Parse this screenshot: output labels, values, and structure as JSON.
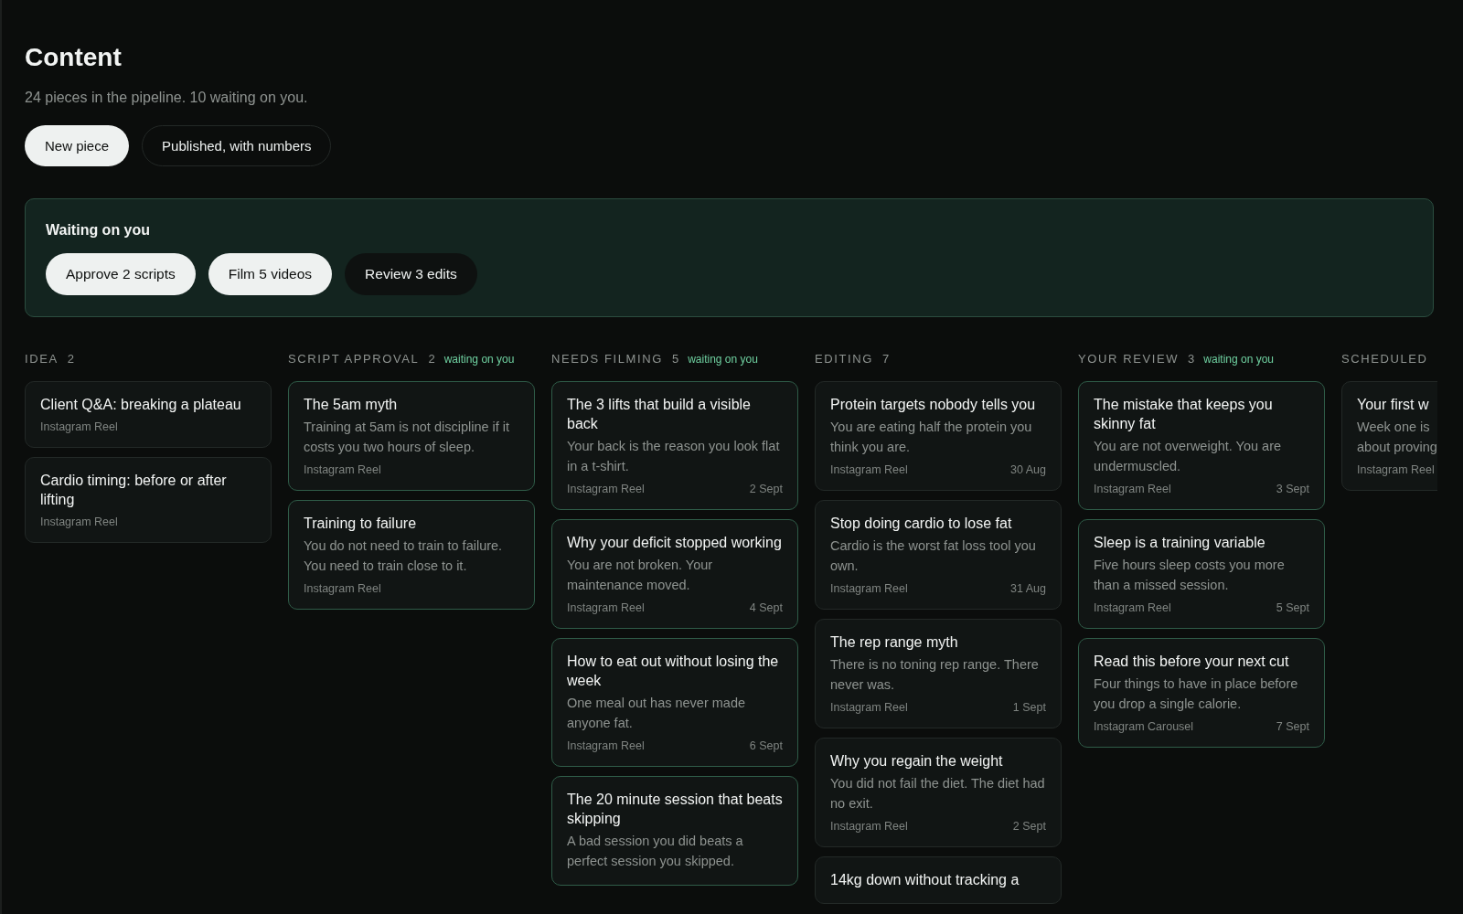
{
  "header": {
    "title": "Content",
    "subtitle": "24 pieces in the pipeline. 10 waiting on you.",
    "actions": [
      {
        "label": "New piece",
        "filled": true
      },
      {
        "label": "Published, with numbers",
        "filled": false
      }
    ]
  },
  "waiting_panel": {
    "title": "Waiting on you",
    "actions": [
      {
        "label": "Approve 2 scripts",
        "filled": true
      },
      {
        "label": "Film 5 videos",
        "filled": true
      },
      {
        "label": "Review 3 edits",
        "filled": false
      }
    ]
  },
  "columns": [
    {
      "name": "IDEA",
      "count": "2",
      "highlighted": false,
      "cards": [
        {
          "title": "Client Q&A: breaking a plateau",
          "format": "Instagram Reel"
        },
        {
          "title": "Cardio timing: before or after lifting",
          "format": "Instagram Reel"
        }
      ]
    },
    {
      "name": "SCRIPT APPROVAL",
      "count": "2",
      "badge": "waiting on you",
      "highlighted": true,
      "cards": [
        {
          "title": "The 5am myth",
          "summary": "Training at 5am is not discipline if it costs you two hours of sleep.",
          "format": "Instagram Reel"
        },
        {
          "title": "Training to failure",
          "summary": "You do not need to train to failure. You need to train close to it.",
          "format": "Instagram Reel"
        }
      ]
    },
    {
      "name": "NEEDS FILMING",
      "count": "5",
      "badge": "waiting on you",
      "highlighted": true,
      "cards": [
        {
          "title": "The 3 lifts that build a visible back",
          "summary": "Your back is the reason you look flat in a t-shirt.",
          "format": "Instagram Reel",
          "date": "2 Sept"
        },
        {
          "title": "Why your deficit stopped working",
          "summary": "You are not broken. Your maintenance moved.",
          "format": "Instagram Reel",
          "date": "4 Sept"
        },
        {
          "title": "How to eat out without losing the week",
          "summary": "One meal out has never made anyone fat.",
          "format": "Instagram Reel",
          "date": "6 Sept"
        },
        {
          "title": "The 20 minute session that beats skipping",
          "summary": "A bad session you did beats a perfect session you skipped."
        }
      ]
    },
    {
      "name": "EDITING",
      "count": "7",
      "highlighted": false,
      "cards": [
        {
          "title": "Protein targets nobody tells you",
          "summary": "You are eating half the protein you think you are.",
          "format": "Instagram Reel",
          "date": "30 Aug"
        },
        {
          "title": "Stop doing cardio to lose fat",
          "summary": "Cardio is the worst fat loss tool you own.",
          "format": "Instagram Reel",
          "date": "31 Aug"
        },
        {
          "title": "The rep range myth",
          "summary": "There is no toning rep range. There never was.",
          "format": "Instagram Reel",
          "date": "1 Sept"
        },
        {
          "title": "Why you regain the weight",
          "summary": "You did not fail the diet. The diet had no exit.",
          "format": "Instagram Reel",
          "date": "2 Sept"
        },
        {
          "title": "14kg down without tracking a"
        }
      ]
    },
    {
      "name": "YOUR REVIEW",
      "count": "3",
      "badge": "waiting on you",
      "highlighted": true,
      "cards": [
        {
          "title": "The mistake that keeps you skinny fat",
          "summary": "You are not overweight. You are undermuscled.",
          "format": "Instagram Reel",
          "date": "3 Sept"
        },
        {
          "title": "Sleep is a training variable",
          "summary": "Five hours sleep costs you more than a missed session.",
          "format": "Instagram Reel",
          "date": "5 Sept"
        },
        {
          "title": "Read this before your next cut",
          "summary": "Four things to have in place before you drop a single calorie.",
          "format": "Instagram Carousel",
          "date": "7 Sept"
        }
      ]
    },
    {
      "name": "SCHEDULED",
      "highlighted": false,
      "cards": [
        {
          "title": "Your first w",
          "summary": "Week one is",
          "summary_2": "about proving",
          "format": "Instagram Reel"
        }
      ]
    }
  ]
}
